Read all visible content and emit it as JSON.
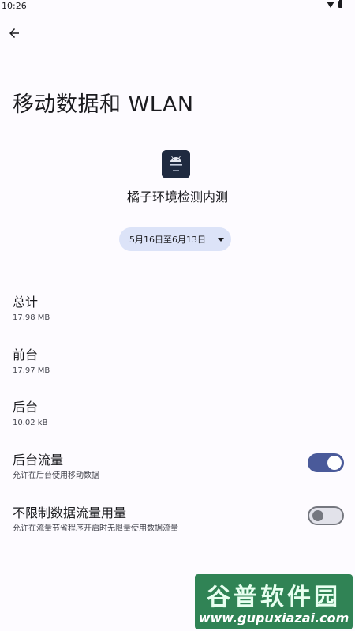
{
  "status_bar": {
    "time": "10:26",
    "icons": [
      "wifi-icon",
      "battery-icon"
    ]
  },
  "header": {
    "back_icon": "arrow-back-icon",
    "title": "移动数据和 WLAN"
  },
  "app": {
    "name": "橘子环境检测内测",
    "icon_color": "#1f2a40"
  },
  "date_range": {
    "label": "5月16日至6月13日"
  },
  "usage": [
    {
      "label": "总计",
      "value": "17.98 MB"
    },
    {
      "label": "前台",
      "value": "17.97 MB"
    },
    {
      "label": "后台",
      "value": "10.02 kB"
    }
  ],
  "toggles": [
    {
      "title": "后台流量",
      "subtitle": "允许在后台使用移动数据",
      "state": "on"
    },
    {
      "title": "不限制数据流量用量",
      "subtitle": "允许在流量节省程序开启时无限量使用数据流量",
      "state": "off"
    }
  ],
  "colors": {
    "background": "#fdfbff",
    "switch_on": "#4a5a9a",
    "switch_off_track": "#e2e2ea",
    "chip": "#dce3f8"
  },
  "watermark": {
    "brand": "谷普软件园",
    "url": "www.gupuxiazai.com"
  }
}
